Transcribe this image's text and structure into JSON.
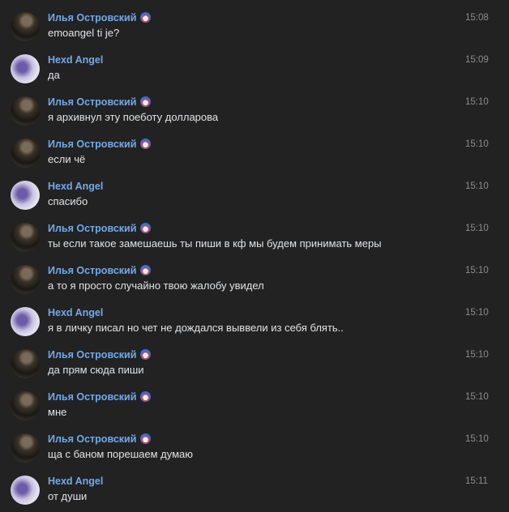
{
  "messages": [
    {
      "author": "Илья Островский",
      "avatar": "ilya",
      "verified": true,
      "time": "15:08",
      "text": "emoangel ti je?"
    },
    {
      "author": "Hexd Angel",
      "avatar": "hexd",
      "verified": false,
      "time": "15:09",
      "text": "да"
    },
    {
      "author": "Илья Островский",
      "avatar": "ilya",
      "verified": true,
      "time": "15:10",
      "text": "я архивнул эту поеботу долларова"
    },
    {
      "author": "Илья Островский",
      "avatar": "ilya",
      "verified": true,
      "time": "15:10",
      "text": "если чё"
    },
    {
      "author": "Hexd Angel",
      "avatar": "hexd",
      "verified": false,
      "time": "15:10",
      "text": "спасибо"
    },
    {
      "author": "Илья Островский",
      "avatar": "ilya",
      "verified": true,
      "time": "15:10",
      "text": "ты если такое замешаешь ты пиши в кф мы будем принимать меры"
    },
    {
      "author": "Илья Островский",
      "avatar": "ilya",
      "verified": true,
      "time": "15:10",
      "text": "а то я просто случайно твою жалобу увидел"
    },
    {
      "author": "Hexd Angel",
      "avatar": "hexd",
      "verified": false,
      "time": "15:10",
      "text": "я в личку писал но чет не дождался выввели из себя блять.."
    },
    {
      "author": "Илья Островский",
      "avatar": "ilya",
      "verified": true,
      "time": "15:10",
      "text": "да прям сюда пиши"
    },
    {
      "author": "Илья Островский",
      "avatar": "ilya",
      "verified": true,
      "time": "15:10",
      "text": "мне"
    },
    {
      "author": "Илья Островский",
      "avatar": "ilya",
      "verified": true,
      "time": "15:10",
      "text": "ща с баном порешаем думаю"
    },
    {
      "author": "Hexd Angel",
      "avatar": "hexd",
      "verified": false,
      "time": "15:11",
      "text": "от души"
    }
  ]
}
